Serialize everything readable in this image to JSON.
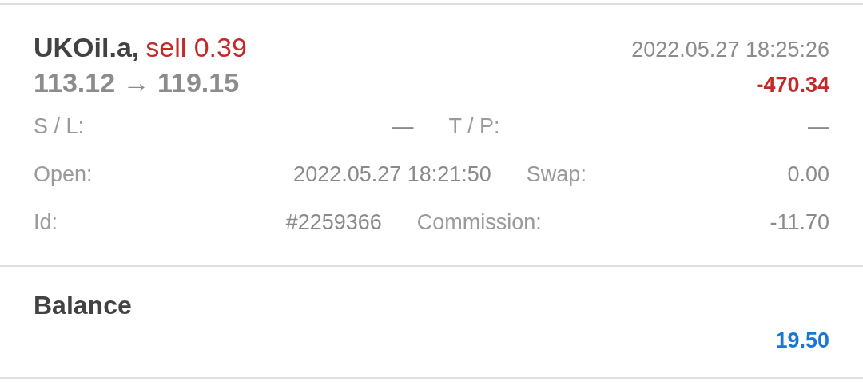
{
  "trade": {
    "symbol": "UKOil.a,",
    "side": "sell 0.39",
    "time": "2022.05.27 18:25:26",
    "prices": "113.12 → 119.15",
    "profit": "-470.34",
    "details": [
      [
        {
          "label": "S / L:",
          "value": "—"
        },
        {
          "label": "T / P:",
          "value": "—"
        }
      ],
      [
        {
          "label": "Open:",
          "value": "2022.05.27 18:21:50"
        },
        {
          "label": "Swap:",
          "value": "0.00"
        }
      ],
      [
        {
          "label": "Id:",
          "value": "#2259366"
        },
        {
          "label": "Commission:",
          "value": "-11.70"
        }
      ]
    ]
  },
  "balance": {
    "title": "Balance",
    "amount": "19.50"
  }
}
